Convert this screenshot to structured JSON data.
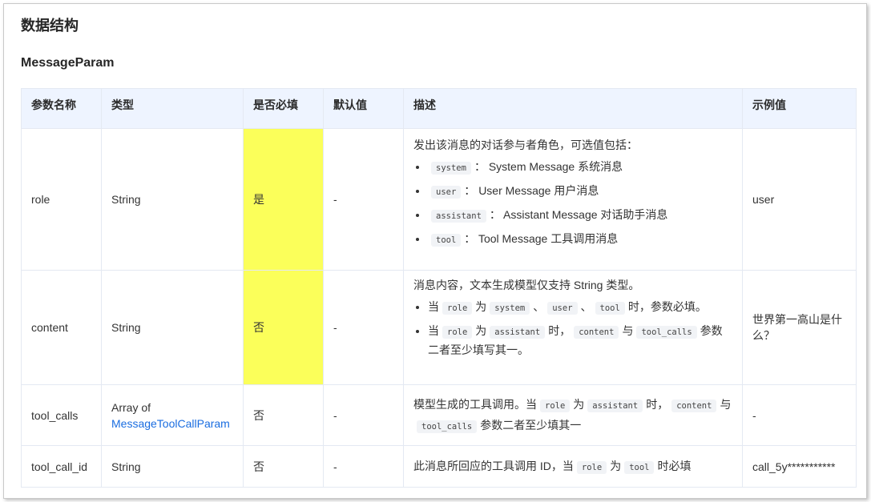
{
  "section_title": "数据结构",
  "sub_title": "MessageParam",
  "table": {
    "headers": [
      "参数名称",
      "类型",
      "是否必填",
      "默认值",
      "描述",
      "示例值"
    ],
    "rows": [
      {
        "name": "role",
        "type_text": "String",
        "required": "是",
        "default": "-",
        "desc_intro": "发出该消息的对话参与者角色，可选值包括：",
        "desc_items": [
          {
            "code": "system",
            "sep": "：",
            "text": "System Message 系统消息"
          },
          {
            "code": "user",
            "sep": "：",
            "text": "User Message 用户消息"
          },
          {
            "code": "assistant",
            "sep": "：",
            "text": "Assistant Message 对话助手消息"
          },
          {
            "code": "tool",
            "sep": "：",
            "text": "Tool Message 工具调用消息"
          }
        ],
        "example": "user"
      },
      {
        "name": "content",
        "type_text": "String",
        "required": "否",
        "default": "-",
        "desc_intro": "消息内容，文本生成模型仅支持 String 类型。",
        "desc_b1": {
          "t1": "当",
          "c1": "role",
          "t2": "为",
          "c2": "system",
          "t3": "、",
          "c3": "user",
          "t4": "、",
          "c4": "tool",
          "t5": "时，参数必填。"
        },
        "desc_b2": {
          "t1": "当",
          "c1": "role",
          "t2": "为",
          "c2": "assistant",
          "t3": "时，",
          "c3": "content",
          "t4": "与",
          "c4": "tool_calls",
          "t5": "参数二者至少填写其一。"
        },
        "example": "世界第一高山是什么？"
      },
      {
        "name": "tool_calls",
        "type_text": "Array of",
        "type_link": "MessageToolCallParam",
        "required": "否",
        "default": "-",
        "desc": {
          "t1": "模型生成的工具调用。当",
          "c1": "role",
          "t2": "为",
          "c2": "assistant",
          "t3": "时，",
          "c3": "content",
          "t4": "与",
          "c4": "tool_calls",
          "t5": "参数二者至少填其一"
        },
        "example": "-"
      },
      {
        "name": "tool_call_id",
        "type_text": "String",
        "required": "否",
        "default": "-",
        "desc": {
          "t1": "此消息所回应的工具调用 ID，当",
          "c1": "role",
          "t2": "为",
          "c2": "tool",
          "t3": "时必填"
        },
        "example": "call_5y***********"
      }
    ]
  },
  "colors": {
    "highlight": "#fbff5a",
    "header_bg": "#eef4ff",
    "link": "#1a6de0",
    "border": "#e4e9f2"
  }
}
